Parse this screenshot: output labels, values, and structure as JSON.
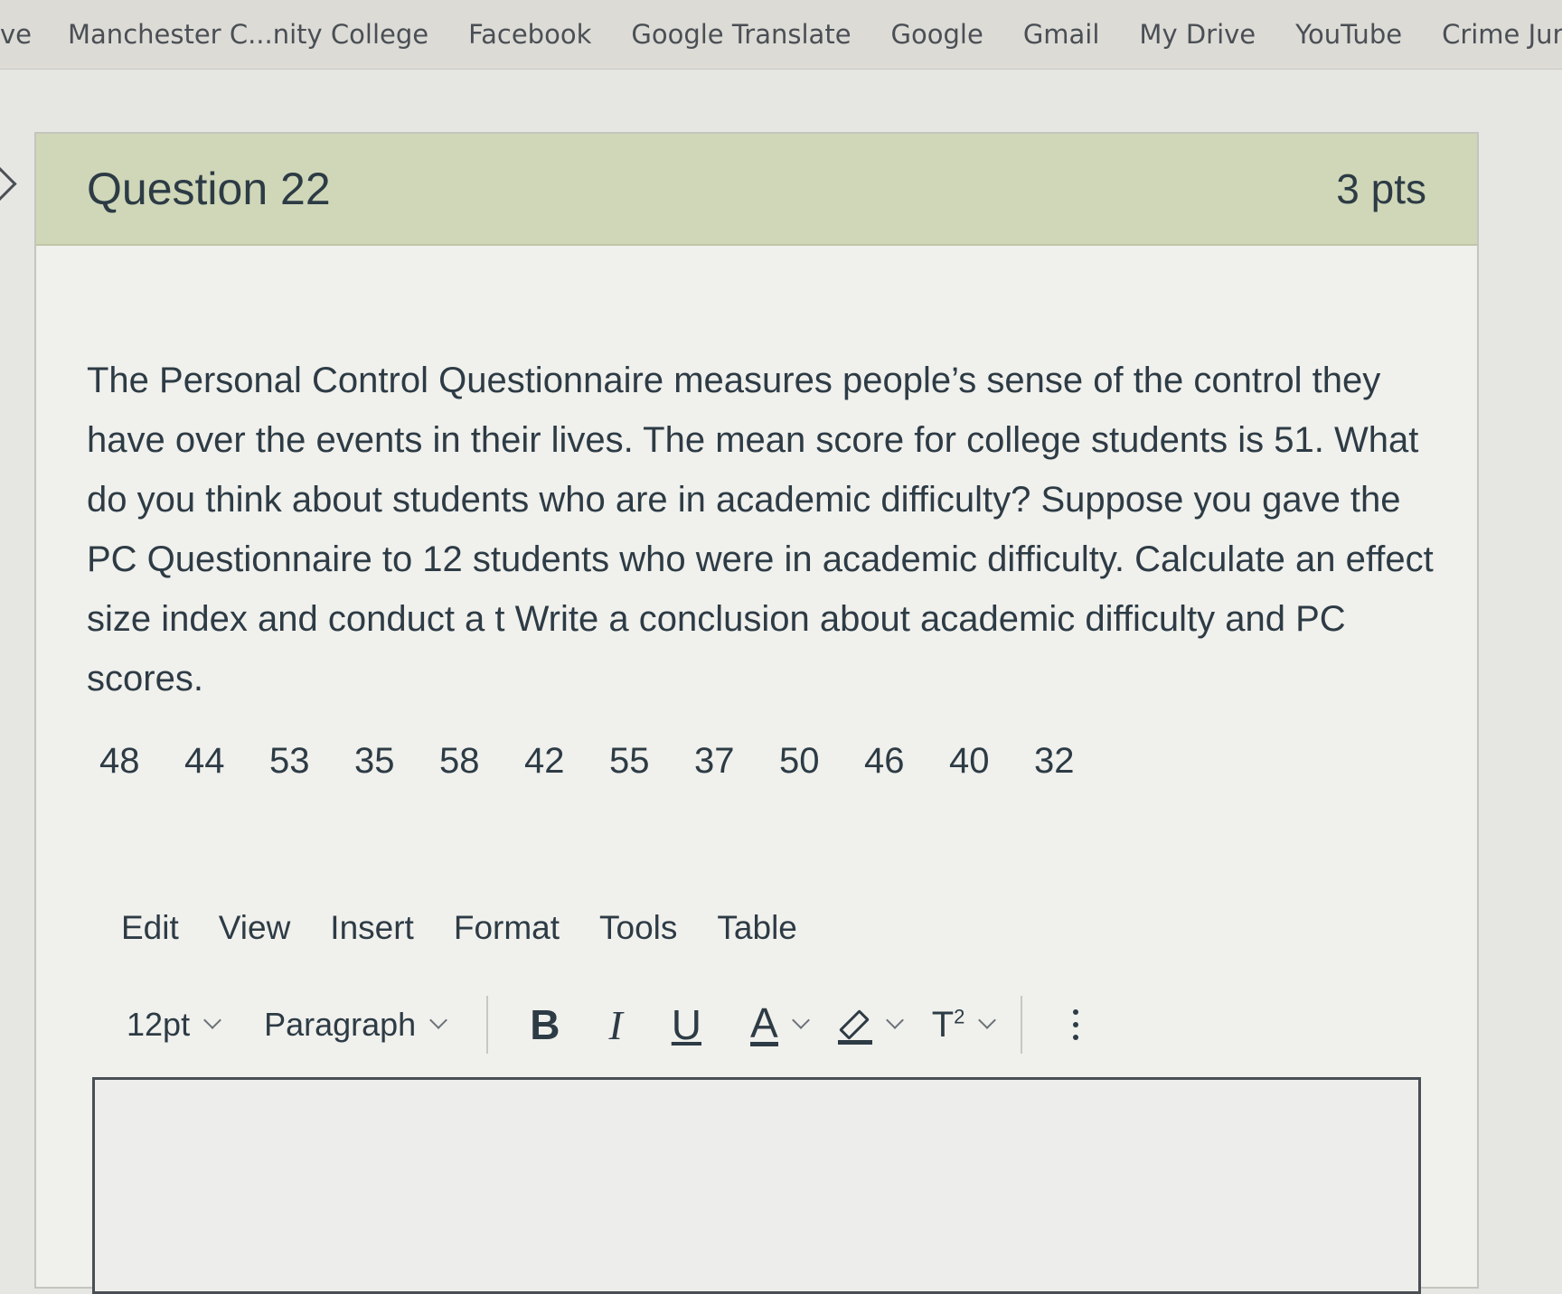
{
  "bookmarks": [
    "ve",
    "Manchester C...nity College",
    "Facebook",
    "Google Translate",
    "Google",
    "Gmail",
    "My Drive",
    "YouTube",
    "Crime Junk"
  ],
  "question": {
    "title": "Question 22",
    "points": "3 pts",
    "text": "The Personal Control Questionnaire measures people’s sense of the control they have over the events in their lives. The mean score for college students is 51. What do you think about students who are in academic difficulty? Suppose you gave the PC Questionnaire to 12 students who were in academic difficulty. Calculate an effect size index and conduct a t Write a conclusion about academic difficulty and PC scores.",
    "data_values": [
      "48",
      "44",
      "53",
      "35",
      "58",
      "42",
      "55",
      "37",
      "50",
      "46",
      "40",
      "32"
    ]
  },
  "editor": {
    "menu": [
      "Edit",
      "View",
      "Insert",
      "Format",
      "Tools",
      "Table"
    ],
    "font_size": "12pt",
    "block_format": "Paragraph",
    "bold_label": "B",
    "italic_label": "I",
    "underline_label": "U",
    "font_color_label": "A",
    "superscript_label": "T",
    "superscript_mark": "2",
    "content": ""
  }
}
